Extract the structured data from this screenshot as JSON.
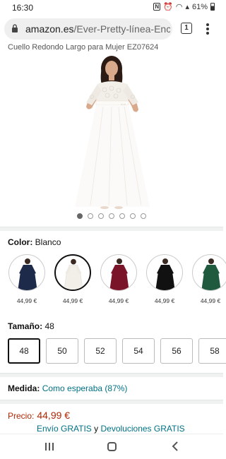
{
  "status_bar": {
    "time": "16:30",
    "battery": "61%"
  },
  "browser": {
    "url_domain": "amazon.es",
    "url_path": "/Ever-Pretty-línea-Enca",
    "tab_count": "1"
  },
  "product": {
    "title_partial": "Cuello Redondo Largo para Mujer EZ07624",
    "image_count": 7,
    "image_active_index": 0
  },
  "color": {
    "label": "Color:",
    "value": "Blanco",
    "options": [
      {
        "name": "navy",
        "color": "#1e2a4a",
        "price": "44,99 €",
        "selected": false
      },
      {
        "name": "white",
        "color": "#f7f5f2",
        "price": "44,99 €",
        "selected": true
      },
      {
        "name": "burgundy",
        "color": "#7a1428",
        "price": "44,99 €",
        "selected": false
      },
      {
        "name": "black",
        "color": "#111111",
        "price": "44,99 €",
        "selected": false
      },
      {
        "name": "green",
        "color": "#1f5a3f",
        "price": "44,99 €",
        "selected": false
      }
    ]
  },
  "size": {
    "label": "Tamaño:",
    "value": "48",
    "options": [
      "48",
      "50",
      "52",
      "54",
      "56",
      "58"
    ]
  },
  "medida": {
    "label": "Medida:",
    "value": "Como esperaba (87%)"
  },
  "price": {
    "label": "Precio:",
    "value": "44,99 €"
  },
  "shipping": {
    "free_shipping": "Envío GRATIS",
    "connector": "y",
    "free_returns": "Devoluciones GRATIS"
  }
}
